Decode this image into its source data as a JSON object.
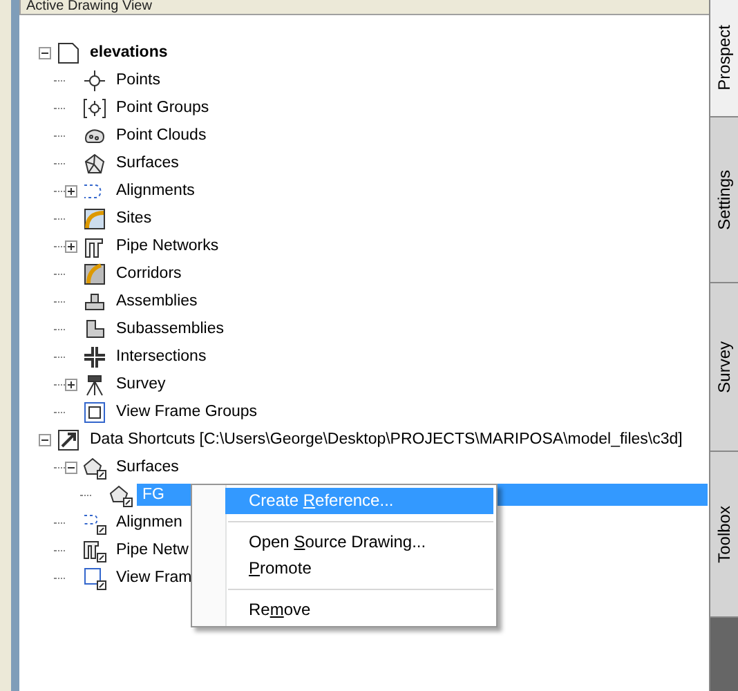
{
  "panel": {
    "title": "Active Drawing View"
  },
  "tree": [
    {
      "label": "elevations",
      "expanded": true,
      "selected": false,
      "children": [
        {
          "label": "Points",
          "selected": false
        },
        {
          "label": "Point Groups",
          "selected": false
        },
        {
          "label": "Point Clouds",
          "selected": false
        },
        {
          "label": "Surfaces",
          "selected": false
        },
        {
          "label": "Alignments",
          "expanded": false,
          "selected": false
        },
        {
          "label": "Sites",
          "selected": false
        },
        {
          "label": "Pipe Networks",
          "expanded": false,
          "selected": false
        },
        {
          "label": "Corridors",
          "selected": false
        },
        {
          "label": "Assemblies",
          "selected": false
        },
        {
          "label": "Subassemblies",
          "selected": false
        },
        {
          "label": "Intersections",
          "selected": false
        },
        {
          "label": "Survey",
          "expanded": false,
          "selected": false
        },
        {
          "label": "View Frame Groups",
          "selected": false
        }
      ]
    },
    {
      "label": "Data Shortcuts [C:\\Users\\George\\Desktop\\PROJECTS\\MARIPOSA\\model_files\\c3d]",
      "expanded": true,
      "selected": false,
      "children": [
        {
          "label": "Surfaces",
          "expanded": true,
          "selected": false,
          "children": [
            {
              "label": "FG",
              "selected": true
            }
          ]
        },
        {
          "label": "Alignmen",
          "selected": false
        },
        {
          "label": "Pipe Netw",
          "selected": false
        },
        {
          "label": "View Fram",
          "selected": false
        }
      ]
    }
  ],
  "context_menu": [
    {
      "kind": "item",
      "before": "Create ",
      "key": "R",
      "after": "eference...",
      "selected": true
    },
    {
      "kind": "separator"
    },
    {
      "kind": "item",
      "before": "Open ",
      "key": "S",
      "after": "ource Drawing...",
      "selected": false
    },
    {
      "kind": "item",
      "key": "P",
      "after": "romote",
      "selected": false
    },
    {
      "kind": "separator"
    },
    {
      "kind": "item",
      "before": "Re",
      "key": "m",
      "after": "ove",
      "selected": false
    }
  ],
  "side_tabs": [
    {
      "label": "Prospect",
      "selected": true
    },
    {
      "label": "Settings",
      "selected": false
    },
    {
      "label": "Survey",
      "selected": false
    },
    {
      "label": "Toolbox",
      "selected": false
    }
  ]
}
